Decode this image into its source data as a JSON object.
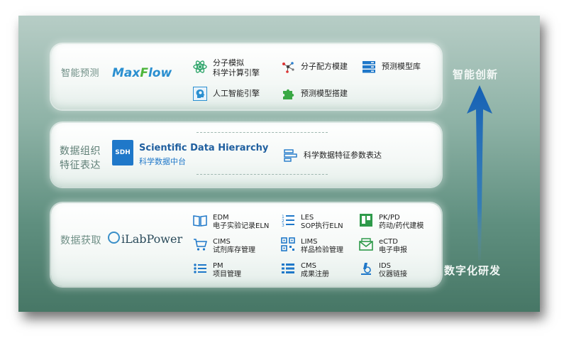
{
  "layers": {
    "top": {
      "label": "智能预测",
      "logo": {
        "prefix": "Max",
        "x": "F",
        "suffix": "low"
      },
      "items": [
        {
          "icon": "atom-icon",
          "line1": "分子模拟",
          "line2": "科学计算引擎"
        },
        {
          "icon": "molecule-icon",
          "line1": "分子配方模建",
          "line2": ""
        },
        {
          "icon": "server-icon",
          "line1": "预测模型库",
          "line2": ""
        },
        {
          "icon": "ai-head-icon",
          "line1": "人工智能引擎",
          "line2": ""
        },
        {
          "icon": "puzzle-icon",
          "line1": "预测模型搭建",
          "line2": ""
        }
      ]
    },
    "middle": {
      "label_line1": "数据组织",
      "label_line2": "特征表达",
      "logo_mark": "SDH",
      "logo_title": "Scientific Data Hierarchy",
      "logo_sub": "科学数据中台",
      "item": {
        "icon": "feature-icon",
        "text": "科学数据特征参数表达"
      }
    },
    "bottom": {
      "label": "数据获取",
      "logo": "iLabPower",
      "items": [
        {
          "icon": "book-icon",
          "line1": "EDM",
          "line2": "电子实验记录ELN"
        },
        {
          "icon": "numbered-list-icon",
          "line1": "LES",
          "line2": "SOP执行ELN"
        },
        {
          "icon": "board-icon",
          "line1": "PK/PD",
          "line2": "药动/药代建模"
        },
        {
          "icon": "cart-icon",
          "line1": "CIMS",
          "line2": "试剂库存管理"
        },
        {
          "icon": "qr-icon",
          "line1": "LIMS",
          "line2": "样品检验管理"
        },
        {
          "icon": "envelope-icon",
          "line1": "eCTD",
          "line2": "电子申报"
        },
        {
          "icon": "list-icon",
          "line1": "PM",
          "line2": "项目管理"
        },
        {
          "icon": "list-alt-icon",
          "line1": "CMS",
          "line2": "成果注册"
        },
        {
          "icon": "microscope-icon",
          "line1": "IDS",
          "line2": "仪器链接"
        }
      ]
    }
  },
  "side": {
    "top": "智能创新",
    "bottom": "数字化研发"
  },
  "colors": {
    "accent_blue": "#1f78c9",
    "accent_green": "#4cb53a",
    "arrow": "#1a66b8"
  }
}
